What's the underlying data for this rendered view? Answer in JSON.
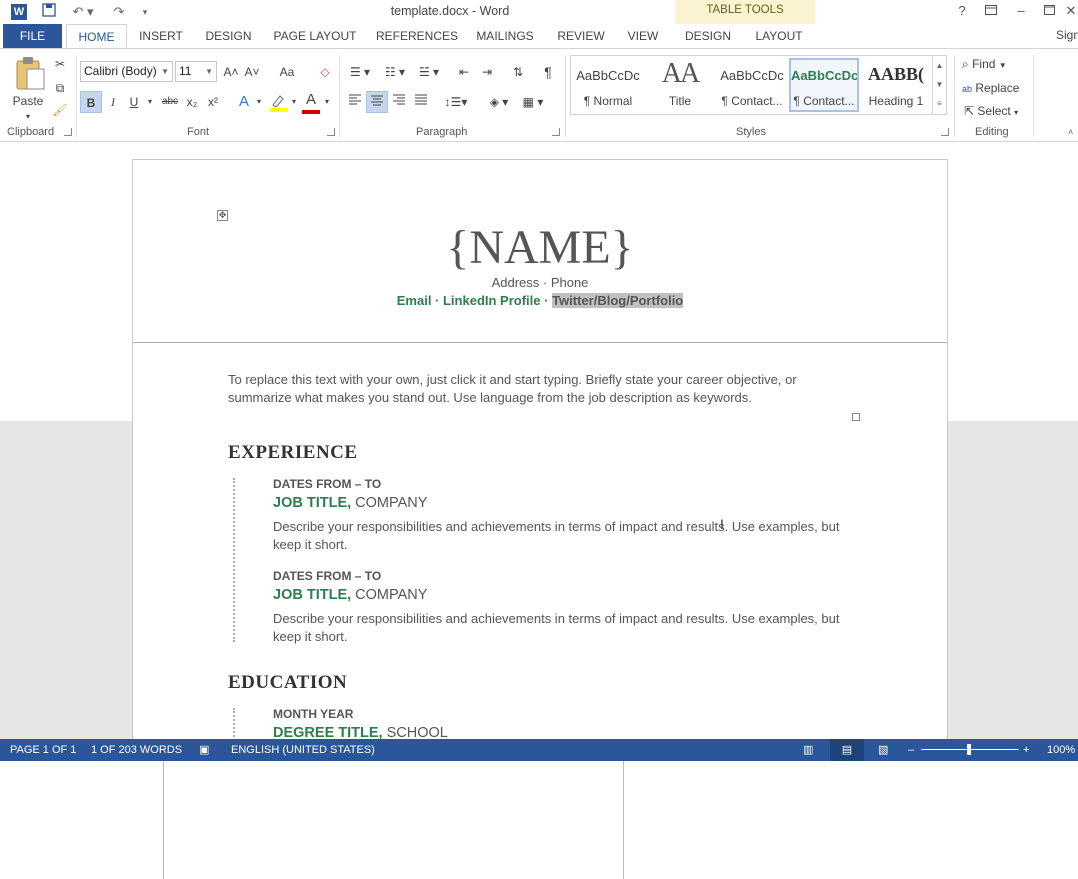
{
  "window": {
    "title": "template.docx - Word",
    "signin": "Sign"
  },
  "context_tab_group": "TABLE TOOLS",
  "tabs": {
    "file": "FILE",
    "home": "HOME",
    "insert": "INSERT",
    "design": "DESIGN",
    "page_layout": "PAGE LAYOUT",
    "references": "REFERENCES",
    "mailings": "MAILINGS",
    "review": "REVIEW",
    "view": "VIEW",
    "tt_design": "DESIGN",
    "tt_layout": "LAYOUT"
  },
  "ribbon": {
    "clipboard": {
      "label": "Clipboard",
      "paste": "Paste"
    },
    "font": {
      "label": "Font",
      "family": "Calibri (Body)",
      "size": "11",
      "bold": "B",
      "italic": "I",
      "underline": "U",
      "strike": "abc",
      "subscript": "x₂",
      "superscript": "x²",
      "grow": "A˄",
      "shrink": "A˅",
      "case": "Aa",
      "color_a": "A",
      "effects": "A"
    },
    "paragraph": {
      "label": "Paragraph",
      "pilcrow": "¶"
    },
    "styles": {
      "label": "Styles",
      "items": [
        {
          "preview": "AaBbCcDc",
          "name": "¶ Normal"
        },
        {
          "preview": "AA",
          "name": "Title"
        },
        {
          "preview": "AaBbCcDc",
          "name": "¶ Contact..."
        },
        {
          "preview": "AaBbCcDc",
          "name": "¶ Contact..."
        },
        {
          "preview": "AABB(",
          "name": "Heading 1"
        }
      ]
    },
    "editing": {
      "label": "Editing",
      "find": "Find",
      "replace": "Replace",
      "select": "Select"
    }
  },
  "document": {
    "name": "{NAME}",
    "address": "Address · Phone",
    "contact_plain": "Email · LinkedIn Profile · ",
    "contact_highlight": "Twitter/Blog/Portfolio",
    "objective": "To replace this text with your own, just click it and start typing. Briefly state your career objective, or summarize what makes you stand out. Use language from the job description as keywords.",
    "experience_title": "EXPERIENCE",
    "experience": [
      {
        "dates": "DATES FROM – TO",
        "job": "JOB TITLE,",
        "company": " COMPANY",
        "desc": "Describe your responsibilities and achievements in terms of impact and results. Use examples, but keep it short."
      },
      {
        "dates": "DATES FROM – TO",
        "job": "JOB TITLE,",
        "company": " COMPANY",
        "desc": "Describe your responsibilities and achievements in terms of impact and results. Use examples, but keep it short."
      }
    ],
    "education_title": "EDUCATION",
    "education": {
      "dates": "MONTH YEAR",
      "degree": "DEGREE TITLE,",
      "school": " SCHOOL"
    }
  },
  "status": {
    "page": "PAGE 1 OF 1",
    "words": "1 OF 203 WORDS",
    "language": "ENGLISH (UNITED STATES)",
    "zoom": "100%",
    "zoom_level": 1.0
  },
  "colors": {
    "brand": "#2b579a",
    "accent_green": "#2e7d4f",
    "table_tools": "#fbf3d2"
  }
}
